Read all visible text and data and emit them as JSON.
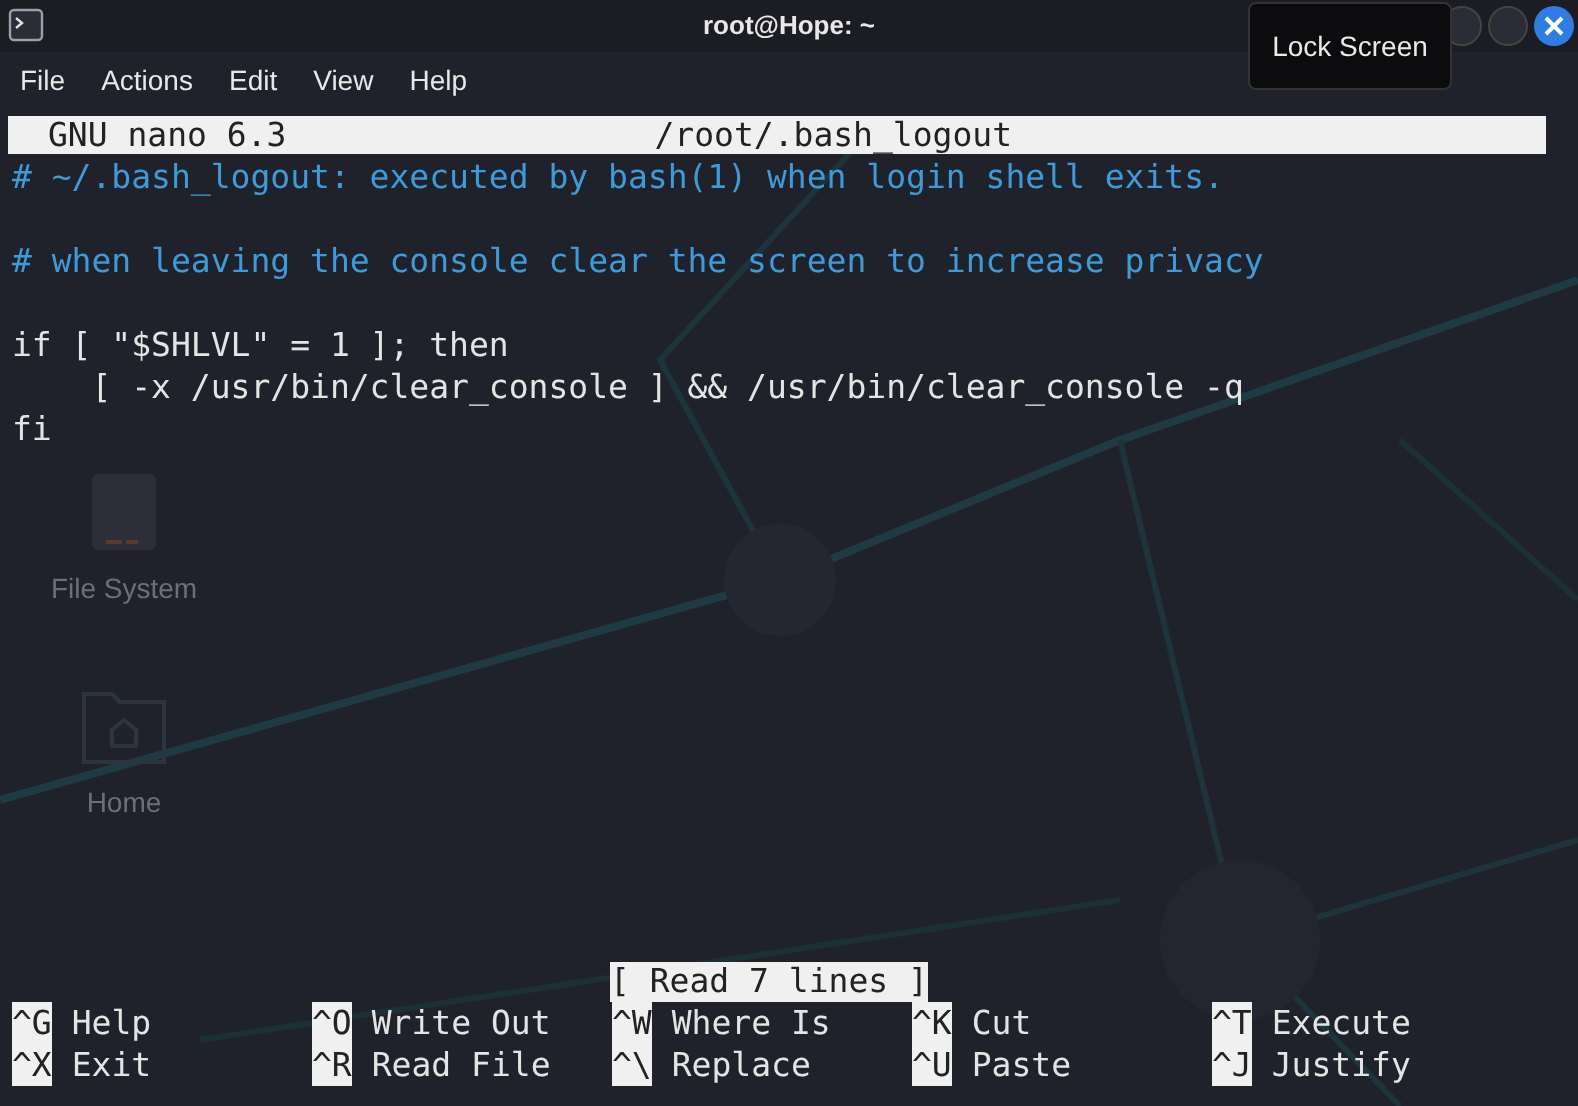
{
  "window": {
    "title": "root@Hope: ~"
  },
  "tooltip": "Lock Screen",
  "menu": [
    "File",
    "Actions",
    "Edit",
    "View",
    "Help"
  ],
  "desktop_icons": [
    {
      "kind": "drive",
      "label": "File System"
    },
    {
      "kind": "folder",
      "label": "Home"
    }
  ],
  "nano": {
    "version": "GNU nano 6.3",
    "file": "/root/.bash_logout",
    "lines": [
      {
        "kind": "comment",
        "text": "# ~/.bash_logout: executed by bash(1) when login shell exits."
      },
      {
        "kind": "blank"
      },
      {
        "kind": "comment",
        "text": "# when leaving the console clear the screen to increase privacy"
      },
      {
        "kind": "blank"
      },
      {
        "kind": "code",
        "text": "if [ \"$SHLVL\" = 1 ]; then"
      },
      {
        "kind": "code",
        "text": "    [ -x /usr/bin/clear_console ] && /usr/bin/clear_console -q"
      },
      {
        "kind": "code",
        "text": "fi"
      }
    ],
    "status": "[ Read 7 lines ]",
    "shortcuts": [
      [
        {
          "key": "^G",
          "label": "Help"
        },
        {
          "key": "^O",
          "label": "Write Out"
        },
        {
          "key": "^W",
          "label": "Where Is"
        },
        {
          "key": "^K",
          "label": "Cut"
        },
        {
          "key": "^T",
          "label": "Execute"
        }
      ],
      [
        {
          "key": "^X",
          "label": "Exit"
        },
        {
          "key": "^R",
          "label": "Read File"
        },
        {
          "key": "^\\",
          "label": "Replace"
        },
        {
          "key": "^U",
          "label": "Paste"
        },
        {
          "key": "^J",
          "label": "Justify"
        }
      ]
    ]
  }
}
